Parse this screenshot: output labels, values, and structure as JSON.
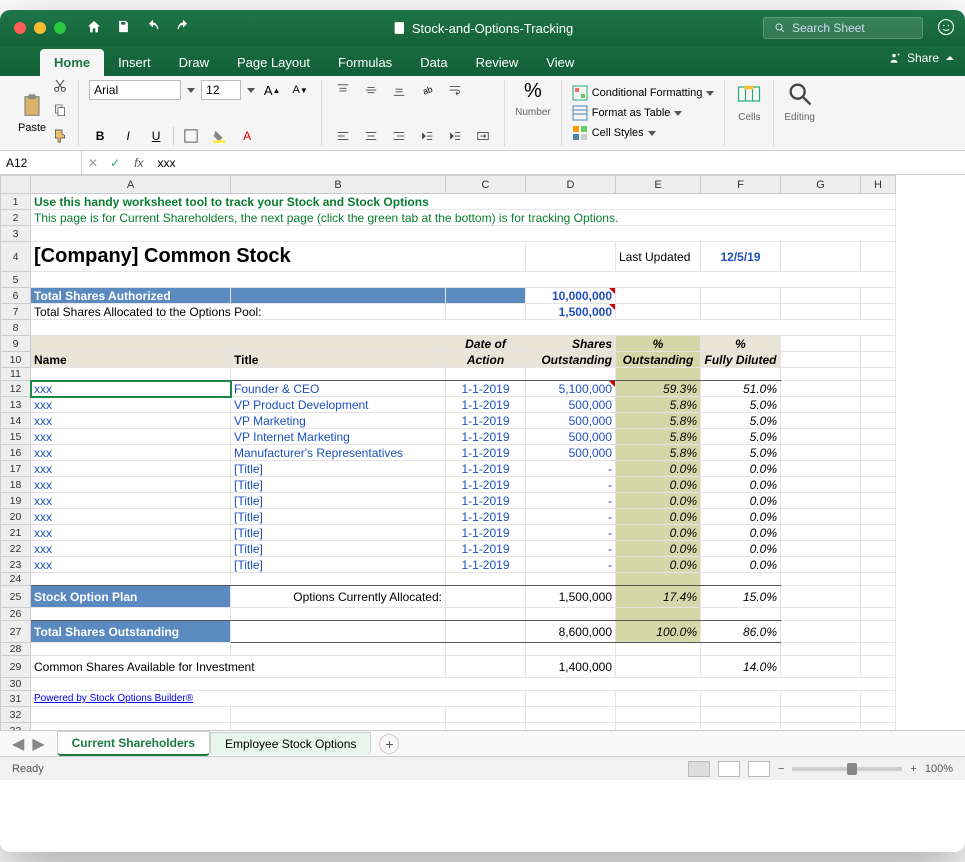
{
  "title": "Stock-and-Options-Tracking",
  "search_placeholder": "Search Sheet",
  "tabs": [
    "Home",
    "Insert",
    "Draw",
    "Page Layout",
    "Formulas",
    "Data",
    "Review",
    "View"
  ],
  "share": "Share",
  "ribbon": {
    "paste": "Paste",
    "font_name": "Arial",
    "font_size": "12",
    "groups": {
      "number": "Number",
      "cells": "Cells",
      "editing": "Editing"
    },
    "styles": {
      "cond": "Conditional Formatting",
      "table": "Format as Table",
      "cell": "Cell Styles"
    }
  },
  "namebox": "A12",
  "formula": "xxx",
  "cols": [
    "A",
    "B",
    "C",
    "D",
    "E",
    "F",
    "G",
    "H"
  ],
  "widths": [
    200,
    215,
    80,
    90,
    85,
    80,
    80,
    35
  ],
  "rows": {
    "r1": "Use this handy worksheet tool to track your Stock and Stock Options",
    "r2": "This page is for Current Shareholders, the next page (click the green tab at the bottom) is for tracking Options.",
    "r4_title": "[Company] Common Stock",
    "r4_last": "Last Updated",
    "r4_date": "12/5/19",
    "r6_label": "Total Shares Authorized",
    "r6_val": "10,000,000",
    "r7_label": "Total Shares Allocated to the Options Pool:",
    "r7_val": "1,500,000",
    "hdr": {
      "name": "Name",
      "title": "Title",
      "date": "Date of Action",
      "shares": "Shares Outstanding",
      "pout": "% Outstanding",
      "pfd": "% Fully Diluted"
    },
    "stock_plan": "Stock Option Plan",
    "opt_alloc": "Options Currently Allocated:",
    "total_out": "Total Shares Outstanding",
    "avail": "Common Shares Available for Investment",
    "powered": "Powered by Stock Options Builder®"
  },
  "data": [
    {
      "row": 12,
      "name": "xxx",
      "title": "Founder & CEO",
      "date": "1-1-2019",
      "shares": "5,100,000",
      "pout": "59.3%",
      "pfd": "51.0%",
      "indic": true
    },
    {
      "row": 13,
      "name": "xxx",
      "title": "VP Product Development",
      "date": "1-1-2019",
      "shares": "500,000",
      "pout": "5.8%",
      "pfd": "5.0%"
    },
    {
      "row": 14,
      "name": "xxx",
      "title": "VP Marketing",
      "date": "1-1-2019",
      "shares": "500,000",
      "pout": "5.8%",
      "pfd": "5.0%"
    },
    {
      "row": 15,
      "name": "xxx",
      "title": "VP Internet Marketing",
      "date": "1-1-2019",
      "shares": "500,000",
      "pout": "5.8%",
      "pfd": "5.0%"
    },
    {
      "row": 16,
      "name": "xxx",
      "title": "Manufacturer's Representatives",
      "date": "1-1-2019",
      "shares": "500,000",
      "pout": "5.8%",
      "pfd": "5.0%"
    },
    {
      "row": 17,
      "name": "xxx",
      "title": "[Title]",
      "date": "1-1-2019",
      "shares": "-",
      "pout": "0.0%",
      "pfd": "0.0%"
    },
    {
      "row": 18,
      "name": "xxx",
      "title": "[Title]",
      "date": "1-1-2019",
      "shares": "-",
      "pout": "0.0%",
      "pfd": "0.0%"
    },
    {
      "row": 19,
      "name": "xxx",
      "title": "[Title]",
      "date": "1-1-2019",
      "shares": "-",
      "pout": "0.0%",
      "pfd": "0.0%"
    },
    {
      "row": 20,
      "name": "xxx",
      "title": "[Title]",
      "date": "1-1-2019",
      "shares": "-",
      "pout": "0.0%",
      "pfd": "0.0%"
    },
    {
      "row": 21,
      "name": "xxx",
      "title": "[Title]",
      "date": "1-1-2019",
      "shares": "-",
      "pout": "0.0%",
      "pfd": "0.0%"
    },
    {
      "row": 22,
      "name": "xxx",
      "title": "[Title]",
      "date": "1-1-2019",
      "shares": "-",
      "pout": "0.0%",
      "pfd": "0.0%"
    },
    {
      "row": 23,
      "name": "xxx",
      "title": "[Title]",
      "date": "1-1-2019",
      "shares": "-",
      "pout": "0.0%",
      "pfd": "0.0%"
    }
  ],
  "totals": {
    "opt_alloc_val": "1,500,000",
    "opt_alloc_pout": "17.4%",
    "opt_alloc_pfd": "15.0%",
    "total_shares": "8,600,000",
    "total_pout": "100.0%",
    "total_pfd": "86.0%",
    "avail_shares": "1,400,000",
    "avail_pfd": "14.0%"
  },
  "sheets": [
    "Current Shareholders",
    "Employee Stock Options"
  ],
  "status": "Ready",
  "zoom": "100%"
}
